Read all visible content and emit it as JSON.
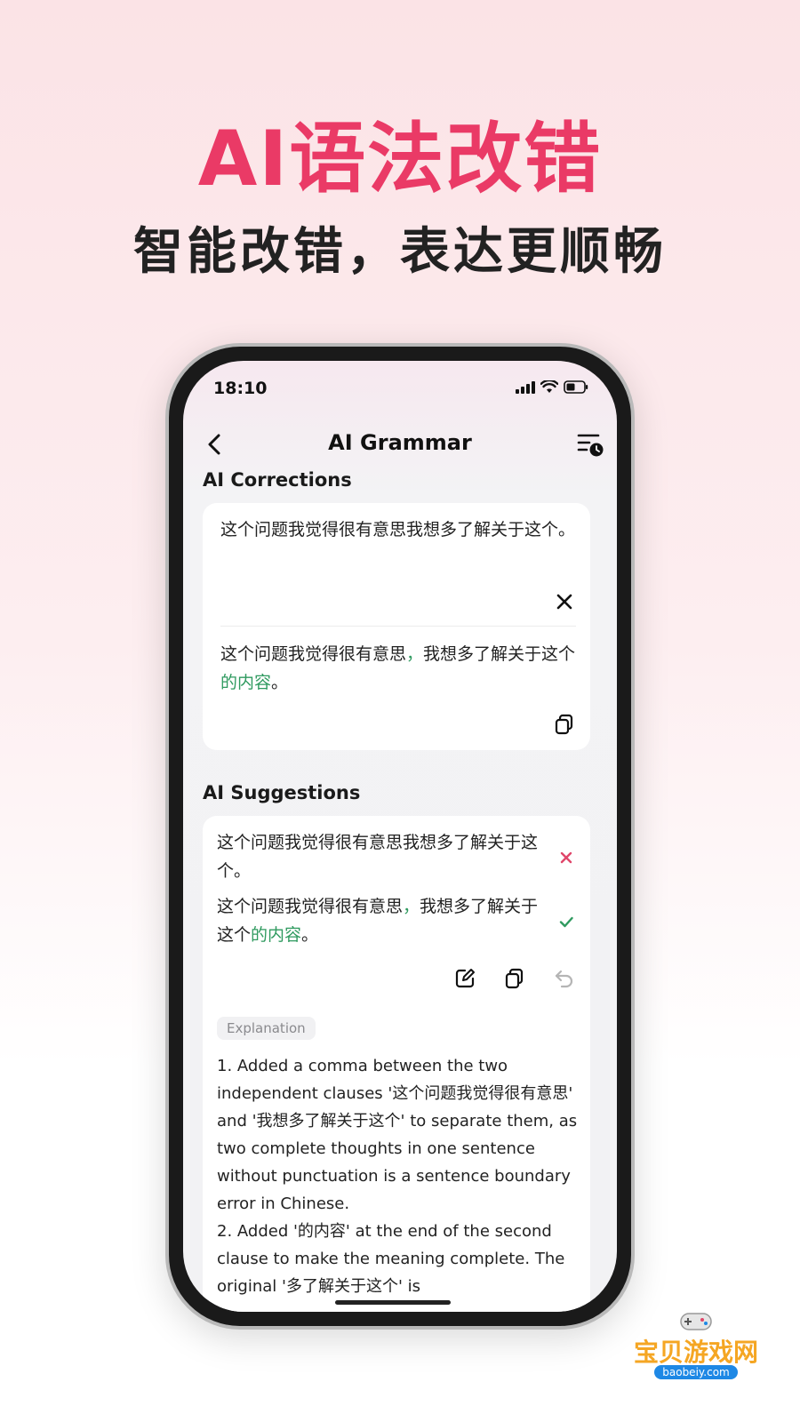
{
  "promo": {
    "title": "AI语法改错",
    "subtitle": "智能改错，表达更顺畅"
  },
  "colors": {
    "title": "#ea3a66",
    "correct_green": "#2f9a5f",
    "wrong_red": "#e0466a",
    "subtitle": "#222222"
  },
  "status_bar": {
    "time": "18:10"
  },
  "nav": {
    "back_icon": "chevron-left-icon",
    "title": "AI Grammar",
    "history_icon": "history-list-icon"
  },
  "corrections": {
    "section_title": "AI Corrections",
    "original": "这个问题我觉得很有意思我想多了解关于这个。",
    "corrected_parts": [
      "这个问题我觉得很有意思",
      "，",
      "我想多了解关于这个",
      "的内容",
      "。"
    ],
    "close_icon": "close-icon",
    "copy_icon": "copy-icon"
  },
  "suggestions": {
    "section_title": "AI Suggestions",
    "wrong_line": "这个问题我觉得很有意思我想多了解关于这个。",
    "right_parts": [
      "这个问题我觉得很有意思",
      "，",
      "我想多了解关于这个",
      "的内容",
      "。"
    ],
    "wrong_icon": "x-mark-icon",
    "right_icon": "check-icon",
    "edit_icon": "edit-icon",
    "copy_icon": "copy-icon",
    "undo_icon": "undo-icon",
    "explanation_label": "Explanation",
    "explanation_text": "1. Added a comma between the two independent clauses '这个问题我觉得很有意思' and '我想多了解关于这个' to separate them, as two complete thoughts in one sentence without punctuation is a sentence boundary error in Chinese.\n2. Added '的内容' at the end of the second clause to make the meaning complete. The original '多了解关于这个' is"
  },
  "watermark": {
    "text": "宝贝游戏网",
    "url": "baobeiy.com"
  }
}
